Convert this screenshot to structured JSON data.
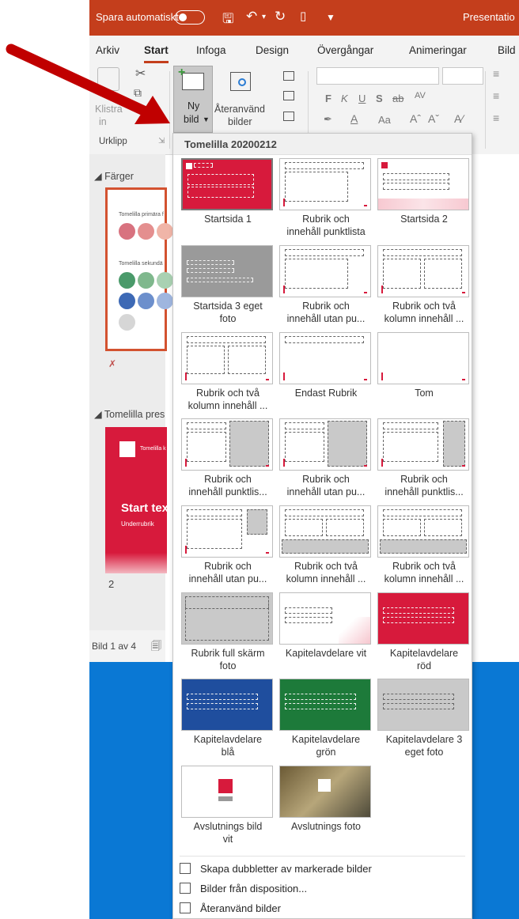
{
  "titlebar": {
    "autosave_label": "Spara automatiskt",
    "doc_title": "Presentatio",
    "color": "#c43e1c"
  },
  "ribbon": {
    "tabs": [
      "Arkiv",
      "Start",
      "Infoga",
      "Design",
      "Övergångar",
      "Animeringar",
      "Bild"
    ],
    "active_tab": "Start",
    "paste_label_1": "Klistra",
    "paste_label_2": "in",
    "new_slide_label_1": "Ny",
    "new_slide_label_2": "bild",
    "reuse_label_1": "Återanvänd",
    "reuse_label_2": "bilder",
    "group_clipboard": "Urklipp",
    "font_size_up": "Aˆ",
    "font_size_down": "Aˇ",
    "font_change_case": "Aa"
  },
  "left_pane": {
    "section_1": "Färger",
    "thumb1_text_1": "Tomelilla primära f",
    "thumb1_text_2": "Tomelilla sekundä",
    "section_2": "Tomelilla pres",
    "thumb2_title": "Start tex",
    "thumb2_sub": "Underrubrik",
    "thumb2_logo_text": "Tomelilla k",
    "slide_number": "2"
  },
  "status": {
    "slide_count": "Bild 1 av 4"
  },
  "gallery": {
    "header": "Tomelilla 20200212",
    "layouts": [
      {
        "line1": "Startsida 1",
        "line2": ""
      },
      {
        "line1": "Rubrik och",
        "line2": "innehåll punktlista"
      },
      {
        "line1": "Startsida 2",
        "line2": ""
      },
      {
        "line1": "Startsida 3 eget",
        "line2": "foto"
      },
      {
        "line1": "Rubrik och",
        "line2": "innehåll utan pu..."
      },
      {
        "line1": "Rubrik och två",
        "line2": "kolumn innehåll ..."
      },
      {
        "line1": "Rubrik och två",
        "line2": "kolumn innehåll ..."
      },
      {
        "line1": "Endast Rubrik",
        "line2": ""
      },
      {
        "line1": "Tom",
        "line2": ""
      },
      {
        "line1": "Rubrik och",
        "line2": "innehåll punktlis..."
      },
      {
        "line1": "Rubrik och",
        "line2": "innehåll utan pu..."
      },
      {
        "line1": "Rubrik och",
        "line2": "innehåll punktlis..."
      },
      {
        "line1": "Rubrik och",
        "line2": "innehåll utan pu..."
      },
      {
        "line1": "Rubrik och två",
        "line2": "kolumn innehåll ..."
      },
      {
        "line1": "Rubrik och två",
        "line2": "kolumn innehåll ..."
      },
      {
        "line1": "Rubrik full skärm",
        "line2": "foto"
      },
      {
        "line1": "Kapitelavdelare vit",
        "line2": ""
      },
      {
        "line1": "Kapitelavdelare",
        "line2": "röd"
      },
      {
        "line1": "Kapitelavdelare",
        "line2": "blå"
      },
      {
        "line1": "Kapitelavdelare",
        "line2": "grön"
      },
      {
        "line1": "Kapitelavdelare 3",
        "line2": "eget foto"
      },
      {
        "line1": "Avslutnings bild",
        "line2": "vit"
      },
      {
        "line1": "Avslutnings foto",
        "line2": ""
      }
    ],
    "menu": [
      "Skapa dubbletter av markerade bilder",
      "Bilder från disposition...",
      "Återanvänd bilder"
    ]
  },
  "colors": {
    "brand_red": "#d71a3c",
    "office_orange": "#c43e1c",
    "chapter_blue": "#1f4e9e",
    "chapter_green": "#1d7a3a",
    "desktop_blue": "#0a78d4",
    "arrow_red": "#c00000"
  }
}
